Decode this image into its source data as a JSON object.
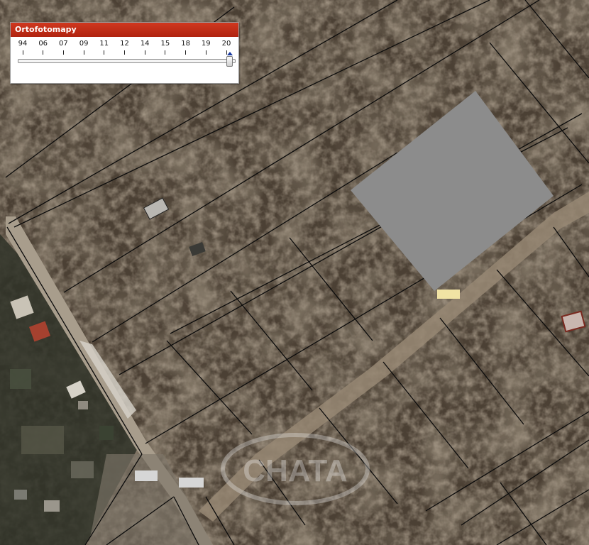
{
  "panel": {
    "title": "Ortofotomapy",
    "years": [
      "94",
      "06",
      "07",
      "09",
      "11",
      "12",
      "14",
      "15",
      "18",
      "19",
      "20"
    ],
    "selected_year": "20"
  },
  "map": {
    "watermark": "CHATA",
    "colors": {
      "ground": "#4b4034",
      "parcel_line": "#0c0c0c",
      "road": "#a89d8c",
      "masked_area": "#8c8c8c",
      "label_highlight": "#f1e3a4",
      "panel_title": "#c0301a"
    }
  }
}
